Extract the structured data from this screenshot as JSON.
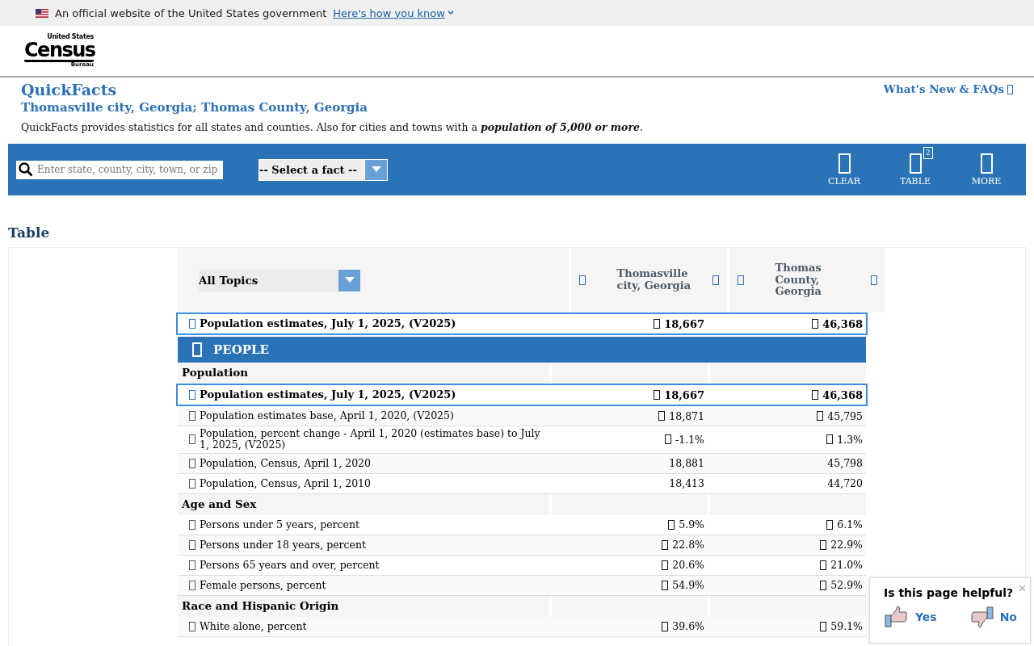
{
  "banner": {
    "text": "An official website of the United States government",
    "link": "Here's how you know"
  },
  "logo": {
    "top": "United States",
    "main": "Census",
    "bottom": "Bureau"
  },
  "header": {
    "title": "QuickFacts",
    "subtitle": "Thomasville city, Georgia; Thomas County, Georgia",
    "description": "QuickFacts provides statistics for all states and counties. Also for cities and towns with a **population of 5,000 or more**.",
    "link": "What's New & FAQs"
  },
  "toolbar": {
    "search": {
      "placeholder": "Enter state, county, city, town, or zip"
    },
    "fact_select": "-- Select a fact --",
    "buttons": [
      {
        "label": "CLEAR"
      },
      {
        "label": "TABLE",
        "badge": "2"
      },
      {
        "label": "MORE"
      }
    ]
  },
  "section_title": "Table",
  "table": {
    "topic_select": "All Topics",
    "columns": [
      "Thomasville city, Georgia",
      "Thomas County, Georgia"
    ],
    "rows": [
      {
        "kind": "highlight",
        "label": "Population estimates, July 1, 2025, (V2025)",
        "values": [
          {
            "text": "18,667",
            "with_icon": true
          },
          {
            "text": "46,368",
            "with_icon": true
          }
        ]
      },
      {
        "kind": "band",
        "label": "PEOPLE"
      },
      {
        "kind": "section",
        "label": "Population"
      },
      {
        "kind": "highlight",
        "label": "Population estimates, July 1, 2025, (V2025)",
        "values": [
          {
            "text": "18,667",
            "with_icon": true
          },
          {
            "text": "46,368",
            "with_icon": true
          }
        ]
      },
      {
        "kind": "fact",
        "label": "Population estimates base, April 1, 2020, (V2025)",
        "values": [
          {
            "text": "18,871",
            "with_icon": true
          },
          {
            "text": "45,795",
            "with_icon": true
          }
        ]
      },
      {
        "kind": "fact",
        "label": "Population, percent change - April 1, 2020 (estimates base) to July 1, 2025, (V2025)",
        "values": [
          {
            "text": "-1.1%",
            "with_icon": true
          },
          {
            "text": "1.3%",
            "with_icon": true
          }
        ]
      },
      {
        "kind": "fact",
        "label": "Population, Census, April 1, 2020",
        "values": [
          {
            "text": "18,881",
            "with_icon": false
          },
          {
            "text": "45,798",
            "with_icon": false
          }
        ]
      },
      {
        "kind": "fact",
        "label": "Population, Census, April 1, 2010",
        "values": [
          {
            "text": "18,413",
            "with_icon": false
          },
          {
            "text": "44,720",
            "with_icon": false
          }
        ]
      },
      {
        "kind": "section",
        "label": "Age and Sex"
      },
      {
        "kind": "fact",
        "label": "Persons under 5 years, percent",
        "values": [
          {
            "text": "5.9%",
            "with_icon": true
          },
          {
            "text": "6.1%",
            "with_icon": true
          }
        ]
      },
      {
        "kind": "fact",
        "label": "Persons under 18 years, percent",
        "values": [
          {
            "text": "22.8%",
            "with_icon": true
          },
          {
            "text": "22.9%",
            "with_icon": true
          }
        ]
      },
      {
        "kind": "fact",
        "label": "Persons 65 years and over, percent",
        "values": [
          {
            "text": "20.6%",
            "with_icon": true
          },
          {
            "text": "21.0%",
            "with_icon": true
          }
        ]
      },
      {
        "kind": "fact",
        "label": "Female persons, percent",
        "values": [
          {
            "text": "54.9%",
            "with_icon": true
          },
          {
            "text": "52.9%",
            "with_icon": true
          }
        ]
      },
      {
        "kind": "section",
        "label": "Race and Hispanic Origin"
      },
      {
        "kind": "fact",
        "label": "White alone, percent",
        "values": [
          {
            "text": "39.6%",
            "with_icon": true
          },
          {
            "text": "59.1%",
            "with_icon": true
          }
        ]
      }
    ]
  },
  "feedback": {
    "question": "Is this page helpful?",
    "yes": "Yes",
    "no": "No"
  }
}
